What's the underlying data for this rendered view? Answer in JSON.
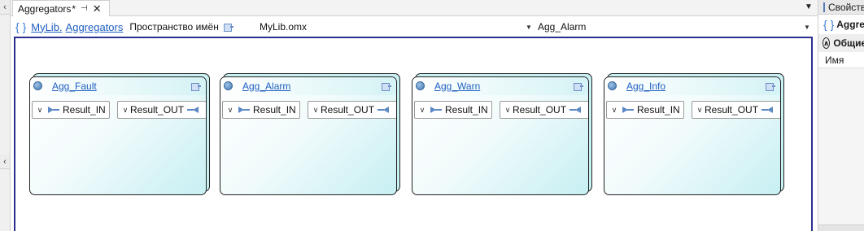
{
  "tab": {
    "title": "Aggregators",
    "modified_marker": "*"
  },
  "nav": {
    "breadcrumbs": [
      "MyLib.",
      "Aggregators"
    ],
    "namespace_label": "Пространство имён",
    "file_combo": "MyLib.omx",
    "type_combo": "Agg_Alarm"
  },
  "blocks": [
    {
      "name": "Agg_Fault",
      "port_in": "Result_IN",
      "port_out": "Result_OUT"
    },
    {
      "name": "Agg_Alarm",
      "port_in": "Result_IN",
      "port_out": "Result_OUT"
    },
    {
      "name": "Agg_Warn",
      "port_in": "Result_IN",
      "port_out": "Result_OUT"
    },
    {
      "name": "Agg_Info",
      "port_in": "Result_IN",
      "port_out": "Result_OUT"
    }
  ],
  "properties": {
    "title": "Свойства",
    "object": "Aggregators",
    "category": "Общие",
    "rows": [
      "Имя"
    ]
  },
  "colors": {
    "link": "#1f5fbf",
    "canvas_border": "#2b2f8f",
    "block_accent": "#c7eff2",
    "pin": "#5b87c5"
  }
}
